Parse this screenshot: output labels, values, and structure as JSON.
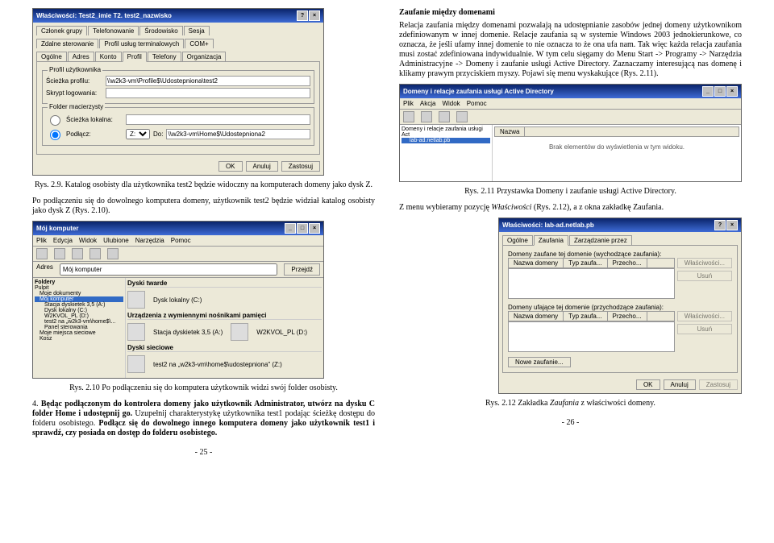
{
  "left": {
    "win1": {
      "title": "Właściwości: Test2_imie T2. test2_nazwisko",
      "tabs_row1": [
        "Członek grupy",
        "Telefonowanie",
        "Środowisko",
        "Sesja"
      ],
      "tabs_row2": [
        "Zdalne sterowanie",
        "Profil usług terminalowych",
        "COM+"
      ],
      "tabs_row3": [
        "Ogólne",
        "Adres",
        "Konto",
        "Profil",
        "Telefony",
        "Organizacja"
      ],
      "section": "Profil użytkownika",
      "path_label": "Ścieżka profilu:",
      "path_value": "\\\\w2k3-vm\\Profile$\\Udostepniona\\test2",
      "script_label": "Skrypt logowania:",
      "folder_section": "Folder macierzysty",
      "local_opt": "Ścieżka lokalna:",
      "connect_opt": "Podłącz:",
      "drive": "Z:",
      "to": "Do:",
      "dest": "\\\\w2k3-vm\\Home$\\Udostepniona2",
      "ok": "OK",
      "cancel": "Anuluj",
      "apply": "Zastosuj"
    },
    "caption1": "Rys. 2.9.  Katalog osobisty dla użytkownika test2 będzie widoczny na komputerach domeny jako dysk Z.",
    "para1": "Po podłączeniu się do dowolnego komputera domeny, użytkownik test2 będzie widział katalog osobisty jako dysk Z (Rys. 2.10).",
    "win2": {
      "title": "Mój komputer",
      "menu": [
        "Plik",
        "Edycja",
        "Widok",
        "Ulubione",
        "Narzędzia",
        "Pomoc"
      ],
      "addr_label": "Adres",
      "addr": "Mój komputer",
      "go": "Przejdź",
      "folders": "Foldery",
      "tree": [
        "Pulpit",
        "Moje dokumenty",
        "Mój komputer",
        "Stacja dyskietek 3,5 (A:)",
        "Dysk lokalny (C:)",
        "W2KVOL_PL (D:)",
        "test2 na „w2k3-vm\\home$\\...",
        "Panel sterowania",
        "Moje miejsca sieciowe",
        "Kosz"
      ],
      "sections": {
        "hd": "Dyski twarde",
        "hd_item": "Dysk lokalny (C:)",
        "rem": "Urządzenia z wymiennymi nośnikami pamięci",
        "rem1": "Stacja dyskietek 3,5 (A:)",
        "rem2": "W2KVOL_PL (D:)",
        "net": "Dyski sieciowe",
        "net_item": "test2 na „w2k3-vm\\home$\\udostepniona\" (Z:)"
      }
    },
    "caption2": "Rys. 2.10 Po podłączeniu się do komputera użytkownik widzi swój folder osobisty.",
    "para2": "4. Będąc podłączonym do kontrolera domeny jako użytkownik Administrator, utwórz na dysku C folder Home i udostępnij go. Uzupełnij charakterystykę użytkownika test1 podając ścieżkę dostępu do folderu osobistego. Podłącz się do dowolnego innego komputera domeny jako użytkownik test1 i sprawdź, czy posiada on dostęp do folderu osobistego.",
    "pageno": "- 25 -"
  },
  "right": {
    "heading": "Zaufanie między domenami",
    "para1": "Relacja zaufania między domenami pozwalają na udostępnianie zasobów jednej domeny użytkownikom zdefiniowanym w innej domenie.  Relacje zaufania są w systemie Windows 2003 jednokierunkowe, co oznacza, że jeśli ufamy innej domenie to nie oznacza to że ona ufa nam. Tak więc każda relacja zaufania musi zostać zdefiniowana indywidualnie. W tym celu sięgamy do Menu Start -> Programy -> Narzędzia Administracyjne -> Domeny i zaufanie usługi Active Directory. Zaznaczamy interesującą nas domenę i klikamy prawym przyciskiem myszy. Pojawi się menu wyskakujące (Rys. 2.11).",
    "win1": {
      "title": "Domeny i relacje zaufania usługi Active Directory",
      "menu": [
        "Plik",
        "Akcja",
        "Widok",
        "Pomoc"
      ],
      "tree_root": "Domeny i relacje zaufania usługi Act",
      "tree_item": "lab-ad.netlab.pb",
      "col": "Nazwa",
      "empty": "Brak elementów do wyświetlenia w tym widoku."
    },
    "caption1": "Rys. 2.11 Przystawka Domeny i zaufanie usługi Active Directory.",
    "para2_a": "Z menu wybieramy pozycję ",
    "para2_i": "Właściwości",
    "para2_b": " (Rys. 2.12), a z okna zakładkę ",
    "para2_c": "Zaufania",
    "para2_d": ".",
    "win2": {
      "title": "Właściwości: lab-ad.netlab.pb",
      "tabs": [
        "Ogólne",
        "Zaufania",
        "Zarządzanie przez"
      ],
      "out_label": "Domeny zaufane tej domenie (wychodzące zaufania):",
      "cols": [
        "Nazwa domeny",
        "Typ zaufa...",
        "Przecho..."
      ],
      "props": "Właściwości...",
      "remove": "Usuń",
      "in_label": "Domeny ufające tej domenie (przychodzące zaufania):",
      "new": "Nowe zaufanie...",
      "ok": "OK",
      "cancel": "Anuluj",
      "apply": "Zastosuj"
    },
    "caption2": "Rys. 2.12 Zakładka Zaufania z właściwości domeny.",
    "pageno": "- 26 -"
  }
}
